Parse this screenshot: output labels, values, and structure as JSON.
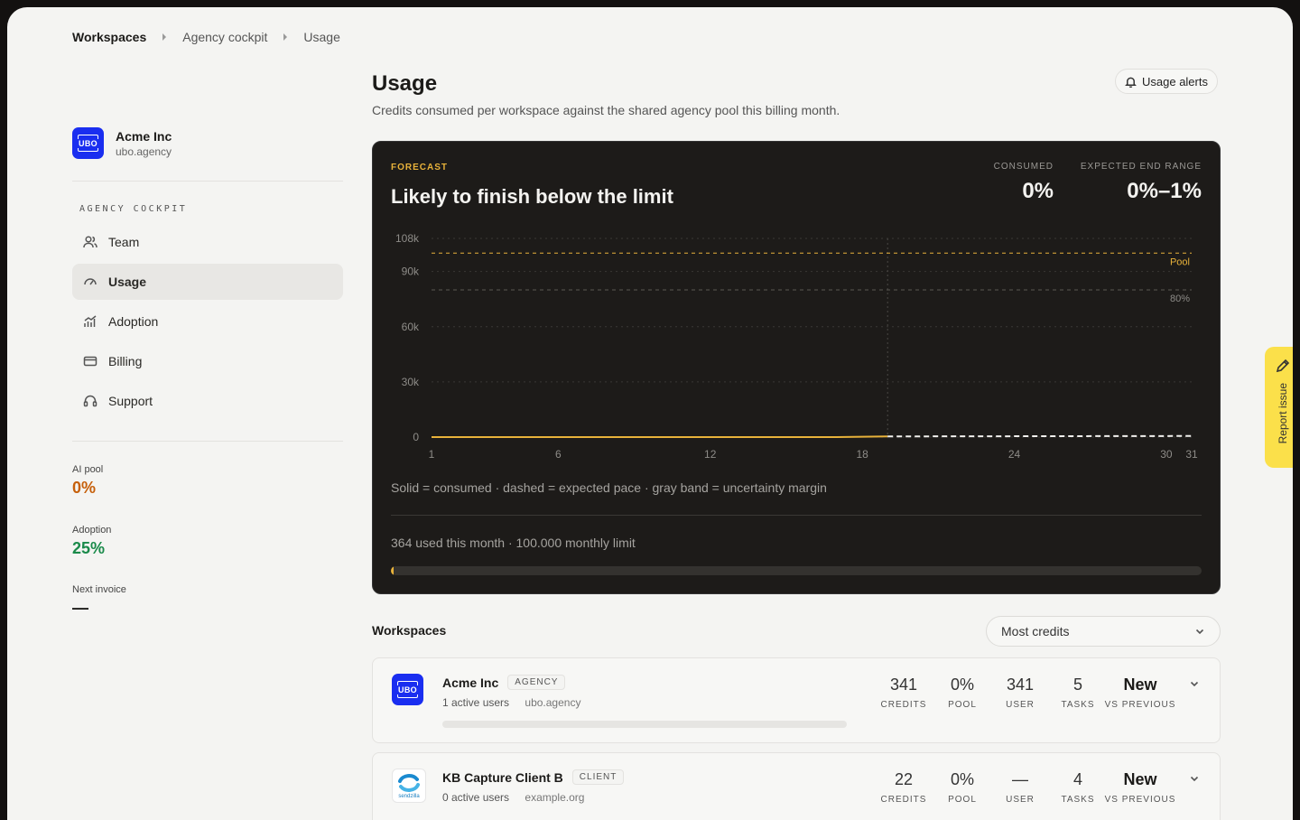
{
  "breadcrumb": [
    "Workspaces",
    "Agency cockpit",
    "Usage"
  ],
  "org": {
    "name": "Acme Inc",
    "domain": "ubo.agency",
    "logo_text": "UBO"
  },
  "sidebar": {
    "section_label": "AGENCY COCKPIT",
    "items": [
      {
        "label": "Team",
        "icon": "users-icon",
        "active": false
      },
      {
        "label": "Usage",
        "icon": "gauge-icon",
        "active": true
      },
      {
        "label": "Adoption",
        "icon": "chart-icon",
        "active": false
      },
      {
        "label": "Billing",
        "icon": "card-icon",
        "active": false
      },
      {
        "label": "Support",
        "icon": "headset-icon",
        "active": false
      }
    ],
    "stats": [
      {
        "label": "AI pool",
        "value": "0%",
        "color": "#c65f0a"
      },
      {
        "label": "Adoption",
        "value": "25%",
        "color": "#1a8a4a"
      },
      {
        "label": "Next invoice",
        "value": "—",
        "color": "#1c1b19"
      }
    ]
  },
  "page": {
    "title": "Usage",
    "subtitle": "Credits consumed per workspace against the shared agency pool this billing month.",
    "alerts_button": "Usage alerts"
  },
  "forecast": {
    "kicker": "FORECAST",
    "headline": "Likely to finish below the limit",
    "consumed_label": "CONSUMED",
    "consumed_value": "0%",
    "range_label": "EXPECTED END RANGE",
    "range_value": "0%–1%",
    "legend": "Solid = consumed · dashed = expected pace · gray band = uncertainty margin",
    "usage_text": "364 used this month · 100.000 monthly limit",
    "usage_fraction": 0.00364
  },
  "chart_data": {
    "type": "line",
    "x_ticks": [
      1,
      6,
      12,
      18,
      24,
      30,
      31
    ],
    "y_ticks": [
      0,
      30000,
      60000,
      90000,
      108000
    ],
    "y_tick_labels": [
      "0",
      "30k",
      "60k",
      "90k",
      "108k"
    ],
    "xlim": [
      1,
      31
    ],
    "ylim": [
      0,
      108000
    ],
    "today": 19,
    "series": [
      {
        "name": "consumed",
        "style": "solid",
        "x": [
          1,
          17,
          19
        ],
        "y": [
          0,
          0,
          364
        ]
      },
      {
        "name": "expected pace",
        "style": "dashed",
        "x": [
          19,
          31
        ],
        "y": [
          364,
          600
        ]
      }
    ],
    "reference_lines": [
      {
        "label": "Pool",
        "y": 100000
      },
      {
        "label": "80%",
        "y": 80000
      }
    ],
    "accent": "#e8b23a"
  },
  "workspaces": {
    "title": "Workspaces",
    "sort_value": "Most credits",
    "rows": [
      {
        "name": "Acme Inc",
        "tag": "AGENCY",
        "users": "1 active users",
        "domain": "ubo.agency",
        "credits": "341",
        "pool": "0%",
        "user": "341",
        "tasks": "5",
        "vs": "New",
        "labels": {
          "credits": "CREDITS",
          "pool": "POOL",
          "user": "USER",
          "tasks": "TASKS",
          "vs": "VS PREVIOUS"
        }
      },
      {
        "name": "KB Capture Client B",
        "tag": "CLIENT",
        "users": "0 active users",
        "domain": "example.org",
        "credits": "22",
        "pool": "0%",
        "user": "—",
        "tasks": "4",
        "vs": "New",
        "labels": {
          "credits": "CREDITS",
          "pool": "POOL",
          "user": "USER",
          "tasks": "TASKS",
          "vs": "VS PREVIOUS"
        },
        "logo_text": "sendzilla"
      }
    ]
  },
  "report": {
    "label": "Report issue"
  }
}
